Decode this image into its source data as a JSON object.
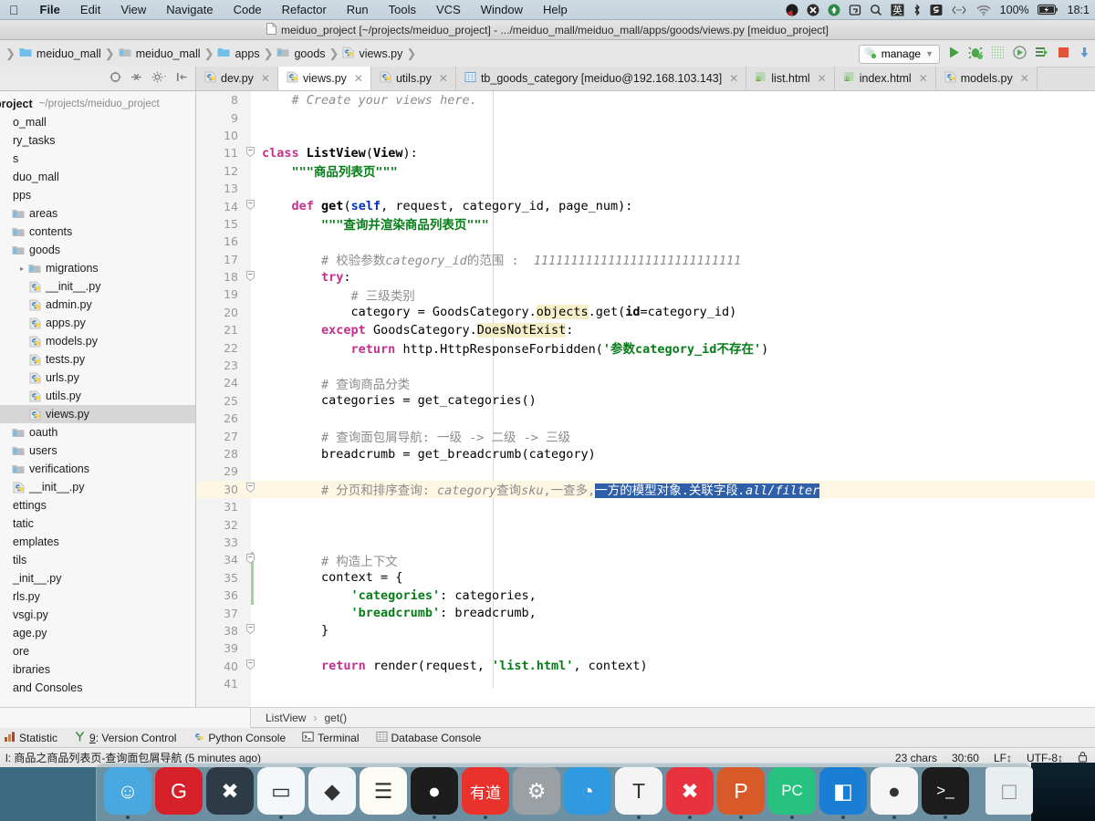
{
  "macbar": {
    "apple": "&#63743;",
    "menus": [
      "File",
      "Edit",
      "View",
      "Navigate",
      "Code",
      "Refactor",
      "Run",
      "Tools",
      "VCS",
      "Window",
      "Help"
    ],
    "status_icons": [
      "webstorm-icon",
      "xmind-icon",
      "updater-icon",
      "screenshot-icon",
      "spotlight-search-icon",
      "chinese-input-icon",
      "bluetooth-icon",
      "sogou-icon",
      "code-icon",
      "wifi-icon"
    ],
    "battery_percent": "100%",
    "battery_icon": "battery-charging-icon",
    "clock": "18:1"
  },
  "window": {
    "title": "meiduo_project [~/projects/meiduo_project] - .../meiduo_mall/meiduo_mall/apps/goods/views.py [meiduo_project]"
  },
  "breadcrumb": {
    "items": [
      {
        "label": "meiduo_mall",
        "icon": "folder-blue-icon"
      },
      {
        "label": "meiduo_mall",
        "icon": "folder-grey-icon"
      },
      {
        "label": "apps",
        "icon": "folder-blue-icon"
      },
      {
        "label": "goods",
        "icon": "folder-grey-icon"
      },
      {
        "label": "views.py",
        "icon": "python-file-icon"
      }
    ]
  },
  "nav_toolbar": {
    "run_config": "manage",
    "buttons": [
      "run-button",
      "debug-button",
      "coverage-button",
      "profile-button",
      "attach-button",
      "stop-button",
      "update-project-button"
    ]
  },
  "left_toolbar": {
    "buttons": [
      "locate-target-icon",
      "collapse-all-icon",
      "settings-gear-icon",
      "hide-panel-icon"
    ]
  },
  "tabs": [
    {
      "label": "dev.py",
      "icon": "python-file-icon",
      "active": false
    },
    {
      "label": "views.py",
      "icon": "python-file-icon",
      "active": true
    },
    {
      "label": "utils.py",
      "icon": "python-file-icon",
      "active": false
    },
    {
      "label": "tb_goods_category [meiduo@192.168.103.143]",
      "icon": "db-table-icon",
      "active": false
    },
    {
      "label": "list.html",
      "icon": "html-file-icon",
      "active": false
    },
    {
      "label": "index.html",
      "icon": "html-file-icon",
      "active": false
    },
    {
      "label": "models.py",
      "icon": "python-file-icon",
      "active": false
    }
  ],
  "project_tree": {
    "header": {
      "label": "project",
      "path": "~/projects/meiduo_project"
    },
    "items": [
      {
        "label": "o_mall",
        "indent": 0,
        "icon": "none",
        "arrow": ""
      },
      {
        "label": "ry_tasks",
        "indent": 0,
        "icon": "none",
        "arrow": ""
      },
      {
        "label": "s",
        "indent": 0,
        "icon": "none",
        "arrow": ""
      },
      {
        "label": "duo_mall",
        "indent": 0,
        "icon": "none",
        "arrow": ""
      },
      {
        "label": "pps",
        "indent": 0,
        "icon": "none",
        "arrow": ""
      },
      {
        "label": "areas",
        "indent": 1,
        "icon": "folder-grey-icon",
        "arrow": ""
      },
      {
        "label": "contents",
        "indent": 1,
        "icon": "folder-grey-icon",
        "arrow": ""
      },
      {
        "label": "goods",
        "indent": 1,
        "icon": "folder-grey-icon",
        "arrow": ""
      },
      {
        "label": "migrations",
        "indent": 2,
        "icon": "folder-grey-icon",
        "arrow": "▸"
      },
      {
        "label": "__init__.py",
        "indent": 2,
        "icon": "python-file-icon",
        "arrow": ""
      },
      {
        "label": "admin.py",
        "indent": 2,
        "icon": "python-file-icon",
        "arrow": ""
      },
      {
        "label": "apps.py",
        "indent": 2,
        "icon": "python-file-icon",
        "arrow": ""
      },
      {
        "label": "models.py",
        "indent": 2,
        "icon": "python-file-icon",
        "arrow": ""
      },
      {
        "label": "tests.py",
        "indent": 2,
        "icon": "python-file-icon",
        "arrow": ""
      },
      {
        "label": "urls.py",
        "indent": 2,
        "icon": "python-file-icon",
        "arrow": ""
      },
      {
        "label": "utils.py",
        "indent": 2,
        "icon": "python-file-icon",
        "arrow": ""
      },
      {
        "label": "views.py",
        "indent": 2,
        "icon": "python-file-icon",
        "arrow": "",
        "selected": true
      },
      {
        "label": "oauth",
        "indent": 1,
        "icon": "folder-grey-icon",
        "arrow": ""
      },
      {
        "label": "users",
        "indent": 1,
        "icon": "folder-grey-icon",
        "arrow": ""
      },
      {
        "label": "verifications",
        "indent": 1,
        "icon": "folder-grey-icon",
        "arrow": ""
      },
      {
        "label": "__init__.py",
        "indent": 1,
        "icon": "python-file-icon",
        "arrow": ""
      },
      {
        "label": "ettings",
        "indent": 0,
        "icon": "none",
        "arrow": ""
      },
      {
        "label": "tatic",
        "indent": 0,
        "icon": "none",
        "arrow": ""
      },
      {
        "label": "emplates",
        "indent": 0,
        "icon": "none",
        "arrow": ""
      },
      {
        "label": "tils",
        "indent": 0,
        "icon": "none",
        "arrow": ""
      },
      {
        "label": "_init__.py",
        "indent": 0,
        "icon": "none",
        "arrow": ""
      },
      {
        "label": "rls.py",
        "indent": 0,
        "icon": "none",
        "arrow": ""
      },
      {
        "label": "vsgi.py",
        "indent": 0,
        "icon": "none",
        "arrow": ""
      },
      {
        "label": "age.py",
        "indent": 0,
        "icon": "none",
        "arrow": ""
      },
      {
        "label": "ore",
        "indent": 0,
        "icon": "none",
        "arrow": ""
      },
      {
        "label": "ibraries",
        "indent": 0,
        "icon": "none",
        "arrow": ""
      },
      {
        "label": " and Consoles",
        "indent": 0,
        "icon": "none",
        "arrow": ""
      }
    ]
  },
  "editor": {
    "first_line_number": 8,
    "lines": [
      {
        "n": 8,
        "html": "<span class=\"cm\">    # Create your views here.</span>"
      },
      {
        "n": 9,
        "html": ""
      },
      {
        "n": 10,
        "html": ""
      },
      {
        "n": 11,
        "html": "<span class=\"kw\">class</span> <span class=\"fn\">ListView</span>(<span class=\"pl\">View</span>):",
        "fold": "⊖"
      },
      {
        "n": 12,
        "html": "<span class=\"st\">    \"\"\"商品列表页\"\"\"</span>"
      },
      {
        "n": 13,
        "html": ""
      },
      {
        "n": 14,
        "html": "    <span class=\"kw\">def</span> <span class=\"fn\">get</span>(<span class=\"k\">self</span>, request, category_id, page_num):",
        "fold": "⊖"
      },
      {
        "n": 15,
        "html": "        <span class=\"st\">\"\"\"查询并渲染商品列表页\"\"\"</span>"
      },
      {
        "n": 16,
        "html": ""
      },
      {
        "n": 17,
        "html": "        <span class=\"cmz\"># 校验参数</span><span class=\"cm\">category_id</span><span class=\"cmz\">的范围 :</span>  <span class=\"cm\">1111111111111111111111111111</span>"
      },
      {
        "n": 18,
        "html": "        <span class=\"kw\">try</span>:",
        "fold": "⊖"
      },
      {
        "n": 19,
        "html": "            <span class=\"cmz\"># 三级类别</span>"
      },
      {
        "n": 20,
        "html": "            category = GoodsCategory.<span class=\"hilite\">objects</span>.get(<span class=\"pl\">id</span>=category_id)"
      },
      {
        "n": 21,
        "html": "        <span class=\"kw\">except</span> GoodsCategory.<span class=\"hilite\">DoesNotExist</span>:"
      },
      {
        "n": 22,
        "html": "            <span class=\"kw\">return</span> http.HttpResponseForbidden(<span class=\"st\">'参数category_id不存在'</span>)"
      },
      {
        "n": 23,
        "html": ""
      },
      {
        "n": 24,
        "html": "        <span class=\"cmz\"># 查询商品分类</span>"
      },
      {
        "n": 25,
        "html": "        categories = get_categories()"
      },
      {
        "n": 26,
        "html": ""
      },
      {
        "n": 27,
        "html": "        <span class=\"cmz\"># 查询面包屑导航: 一级 -> 二级 -> 三级</span>"
      },
      {
        "n": 28,
        "html": "        breadcrumb = get_breadcrumb(category)"
      },
      {
        "n": 29,
        "html": ""
      },
      {
        "n": 30,
        "html": "        <span class=\"cmz\"># 分页和排序查询: </span><span class=\"cm\">category</span><span class=\"cmz\">查询</span><span class=\"cm\">sku</span><span class=\"cmz\">,一查多,</span><span class=\"selblue\">一方的模型对象.关联字段<i>.all/filter</i></span>",
        "highlight": true,
        "fold": "⊖"
      },
      {
        "n": 31,
        "html": ""
      },
      {
        "n": 32,
        "html": ""
      },
      {
        "n": 33,
        "html": ""
      },
      {
        "n": 34,
        "html": "        <span class=\"cmz\"># 构造上下文</span>",
        "fold": "⊖"
      },
      {
        "n": 35,
        "html": "        context = {"
      },
      {
        "n": 36,
        "html": "            <span class=\"st\">'categories'</span>: categories,"
      },
      {
        "n": 37,
        "html": "            <span class=\"st\">'breadcrumb'</span>: breadcrumb,"
      },
      {
        "n": 38,
        "html": "        }",
        "fold": "⊖"
      },
      {
        "n": 39,
        "html": ""
      },
      {
        "n": 40,
        "html": "        <span class=\"kw\">return</span> render(request, <span class=\"st\">'list.html'</span>, context)",
        "fold": "⊖"
      },
      {
        "n": 41,
        "html": ""
      }
    ],
    "selection_text": "一方的模型对象.关联字段.all/filter"
  },
  "editor_breadcrumb": {
    "items": [
      "ListView",
      "get()"
    ],
    "separator": "›"
  },
  "tool_windows": [
    {
      "label": "Statistic",
      "icon": "statistic-icon",
      "prefix": ""
    },
    {
      "label": "9: Version Control",
      "icon": "version-control-icon",
      "prefix": "9"
    },
    {
      "label": "Python Console",
      "icon": "python-console-icon",
      "prefix": ""
    },
    {
      "label": "Terminal",
      "icon": "terminal-icon",
      "prefix": ""
    },
    {
      "label": "Database Console",
      "icon": "database-console-icon",
      "prefix": ""
    }
  ],
  "statusbar": {
    "message": "l: 商品之商品列表页-查询面包屑导航 (5 minutes ago)",
    "chars": "23 chars",
    "caret": "30:60",
    "line_sep": "LF↕",
    "encoding": "UTF-8↕",
    "lock": "ක"
  },
  "dock": {
    "items": [
      {
        "name": "finder-icon",
        "glyph": "☺",
        "bg": "#4aa8e0",
        "running": true
      },
      {
        "name": "gitee-icon",
        "glyph": "G",
        "bg": "#d6202a",
        "running": false
      },
      {
        "name": "vscode-icon",
        "glyph": "✖",
        "bg": "#2d3b47",
        "running": false
      },
      {
        "name": "dash-icon",
        "glyph": "▭",
        "bg": "#f4f7f9",
        "running": true
      },
      {
        "name": "preview-icon",
        "glyph": "◆",
        "bg": "#f2f6f8",
        "running": false
      },
      {
        "name": "notes-icon",
        "glyph": "☰",
        "bg": "#fdfdf5",
        "running": false
      },
      {
        "name": "obs-icon",
        "glyph": "●",
        "bg": "#1d1d1d",
        "running": true
      },
      {
        "name": "youdao-icon",
        "glyph": "有道",
        "bg": "#e8322b",
        "running": true
      },
      {
        "name": "system-preferences-icon",
        "glyph": "⚙",
        "bg": "#9aa0a4",
        "running": false
      },
      {
        "name": "safari-icon",
        "glyph": "◔",
        "bg": "#2f9ae0",
        "running": false
      },
      {
        "name": "typora-icon",
        "glyph": "T",
        "bg": "#f4f4f4",
        "running": true
      },
      {
        "name": "xmind-icon",
        "glyph": "✖",
        "bg": "#e8333f",
        "running": true
      },
      {
        "name": "powerpoint-icon",
        "glyph": "P",
        "bg": "#d85a28",
        "running": true
      },
      {
        "name": "pycharm-icon",
        "glyph": "PC",
        "bg": "#27c27f",
        "running": true
      },
      {
        "name": "datagrip-icon",
        "glyph": "◧",
        "bg": "#1a7fd4",
        "running": true
      },
      {
        "name": "chrome-icon",
        "glyph": "●",
        "bg": "#f5f5f5",
        "running": true
      },
      {
        "name": "iterm-icon",
        "glyph": ">_",
        "bg": "#1c1c1c",
        "running": true
      }
    ],
    "trash": {
      "name": "trash-icon",
      "glyph": "□"
    }
  }
}
